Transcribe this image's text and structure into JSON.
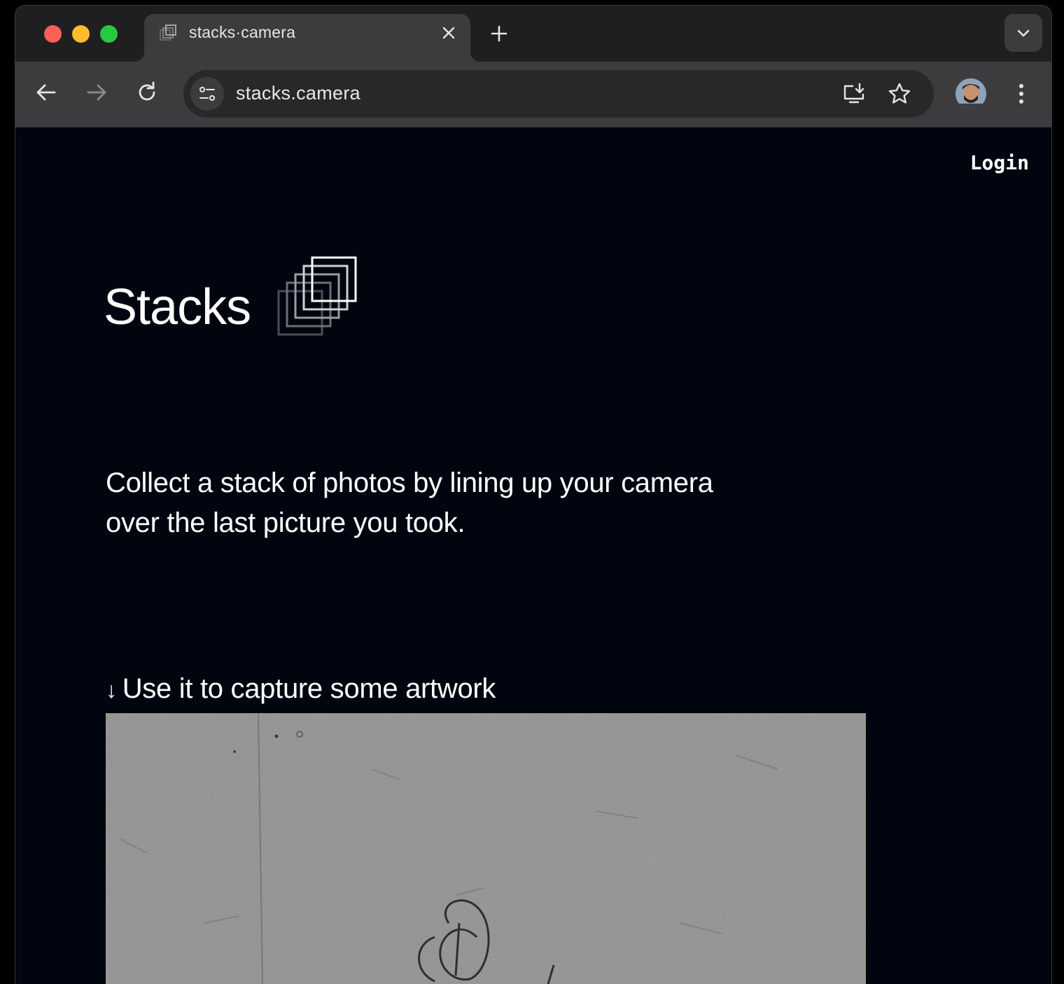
{
  "browser": {
    "tab": {
      "title": "stacks·camera",
      "favicon": "stacks-logo-icon"
    },
    "address_bar": {
      "url": "stacks.camera"
    },
    "toolbar_icons": [
      "back-icon",
      "forward-icon",
      "reload-icon",
      "site-info-icon",
      "install-app-icon",
      "bookmark-star-icon",
      "profile-avatar",
      "more-menu-icon"
    ]
  },
  "page": {
    "nav": {
      "login_label": "Login"
    },
    "brand": {
      "name": "Stacks"
    },
    "tagline": "Collect a stack of photos by lining up your camera over the last picture you took.",
    "section": {
      "arrow": "↓",
      "heading": "Use it to capture some artwork"
    }
  },
  "colors": {
    "page_background": "#01050f",
    "chrome_dark": "#1f1f21",
    "chrome_toolbar": "#3c3c3e",
    "text": "#ffffff",
    "photo_gray": "#8d8c8a"
  }
}
